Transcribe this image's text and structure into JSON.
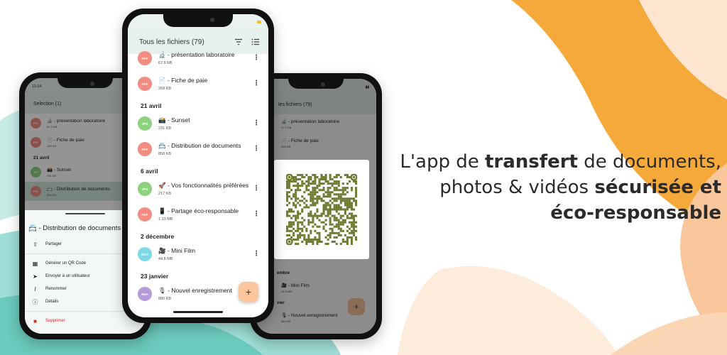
{
  "tagline": {
    "l1a": "L'app de ",
    "l1b": "transfert",
    "l1c": " de documents,",
    "l2a": "photos & vidéos ",
    "l2b": "sécurisée et",
    "l3": "éco-responsable"
  },
  "colors": {
    "orange": "#f6a93b",
    "peach": "#f9c79b",
    "teal": "#7fd1c8",
    "pdf_badge": "#f28b82",
    "jpg_badge": "#8ed17f",
    "mov_badge": "#7fd8e8",
    "m4a_badge": "#b59ad8",
    "delete_red": "#d32f2f"
  },
  "center": {
    "title": "Tous les fichiers (79)",
    "icons": [
      "filter-icon",
      "list-view-icon"
    ],
    "files": [
      {
        "type": "PDF",
        "name": "🔬 - présentation laboratoire",
        "size": "67.9 KB"
      },
      {
        "type": "PDF",
        "name": "📄 - Fiche de paie",
        "size": "268 KB"
      },
      {
        "type": "JPG",
        "name": "📸 - Sunset",
        "size": "231 KB"
      },
      {
        "type": "PDF",
        "name": "📇 - Distribution de documents",
        "size": "858 KB"
      },
      {
        "type": "JPG",
        "name": "🚀 - Vos fonctionnalités préférées",
        "size": "217 KB"
      },
      {
        "type": "PDF",
        "name": "📱 - Partage éco-responsable",
        "size": "1.13 MB"
      },
      {
        "type": "MOV",
        "name": "🎥 - Mini Film",
        "size": "44.8 MB"
      },
      {
        "type": "M4A",
        "name": "🎙 - Nouvel enregistrement",
        "size": "880 KB"
      }
    ],
    "sections": [
      "21 avril",
      "6 avril",
      "2 décembre",
      "23 janvier"
    ],
    "fab": "+"
  },
  "left": {
    "time": "11:14",
    "title": "Selection (1)",
    "files": [
      {
        "type": "PDF",
        "name": "🔬 - présentation laboratoire",
        "size": "67.9 KB"
      },
      {
        "type": "PDF",
        "name": "📄 - Fiche de paie",
        "size": "268 KB"
      },
      {
        "type": "JPG",
        "name": "📸 - Sunset",
        "size": "231 KB"
      },
      {
        "type": "PDF",
        "name": "📇 - Distribution de documents",
        "size": "858 KB"
      }
    ],
    "section": "21 avril",
    "sheet_title": "📇 - Distribution de documents",
    "actions": {
      "share": "Partager",
      "qr": "Générer un QR Code",
      "send": "Envoyer à un utilisateur",
      "rename": "Renommer",
      "details": "Détails",
      "delete": "Supprimer"
    }
  },
  "right": {
    "title": "les fichiers (79)",
    "files": [
      {
        "type": "PDF",
        "name": "🔬 - présentation laboratoire",
        "size": "67.9 KB"
      },
      {
        "type": "PDF",
        "name": "📄 - Fiche de paie",
        "size": "268 KB"
      },
      {
        "type": "MOV",
        "name": "🎥 - Mini Film",
        "size": "44.8 MB"
      },
      {
        "type": "M4A",
        "name": "🎙 - Nouvel enregistrement",
        "size": "880 KB"
      }
    ],
    "sections": [
      "embre",
      "vier"
    ],
    "fab": "+"
  }
}
